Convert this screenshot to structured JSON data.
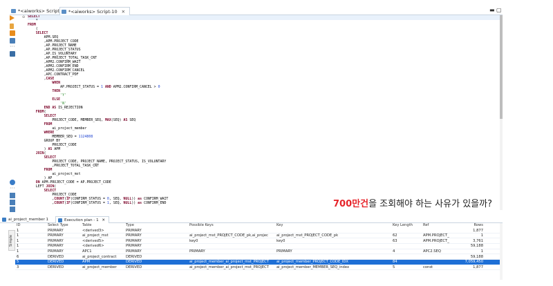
{
  "editor_tabs": [
    {
      "label": "*<aiworks> Script-9",
      "active": false
    },
    {
      "label": "*<aiworks> Script-10",
      "active": true,
      "close": "✕"
    }
  ],
  "window_controls": {
    "minimize": "▬",
    "maximize": "▢"
  },
  "code_lines": [
    "SELECT",
    "    *",
    "FROM",
    "    (",
    "    SELECT",
    "        APM.SEQ",
    "        ,APM.PROJECT_CODE",
    "        ,AP.PROJECT_NAME",
    "        ,AP.PROJECT_STATUS",
    "        ,AP.IS_VOLUNTARY",
    "        ,AP.PROJECT_TOTAL_TASK_CNT",
    "        ,APM2.CONFIRM_WAIT",
    "        ,APM2.CONFIRM_END",
    "        ,APM2.CONFIRM_CANCEL",
    "        ,APC.CONTRACT_PDF",
    "        ,CASE",
    "            WHEN",
    "                AP.PROJECT_STATUS = 1 AND APM2.CONFIRM_CANCEL > 0",
    "            THEN",
    "                'Y'",
    "            ELSE",
    "                'N'",
    "        END AS IS_REJECTION",
    "    FROM(",
    "        SELECT",
    "            PROJECT_CODE, MEMBER_SEQ, MAX(SEQ) AS SEQ",
    "        FROM",
    "            ai_project_member",
    "        WHERE",
    "            MEMBER_SEQ = 1124808",
    "        GROUP BY",
    "            PROJECT_CODE",
    "        ) AS APM",
    "    JOIN(",
    "        SELECT",
    "            PROJECT_CODE, PROJECT_NAME, PROJECT_STATUS, IS_VOLUNTARY",
    "            ,PROJECT_TOTAL_TASK_CNT",
    "        FROM",
    "            ai_project_mst",
    "        ) AP",
    "    ON APM.PROJECT_CODE = AP.PROJECT_CODE",
    "    LEFT JOIN(",
    "        SELECT",
    "            PROJECT_CODE",
    "            ,COUNT(IF(CONFIRM_STATUS = 0, SEQ, NULL)) as CONFIRM_WAIT",
    "            ,COUNT(IF(CONFIRM_STATUS = 1, SEQ, NULL)) as CONFIRM_END"
  ],
  "caption": {
    "highlight": "700만건",
    "rest": "을 조회해야 하는 사유가 있을까?"
  },
  "bottom_tabs": [
    {
      "label": "ai_project_member 1",
      "active": false
    },
    {
      "label": "Execution plan - 1",
      "active": true,
      "close": "✕"
    }
  ],
  "side_label": "Simple",
  "grid": {
    "headers": {
      "id": "ID",
      "select_type": "Select Type",
      "table": "Table",
      "type": "Type",
      "possible_keys": "Possible Keys",
      "key": "Key",
      "key_length": "Key Length",
      "ref": "Ref",
      "rows": "Rows"
    },
    "rows": [
      {
        "id": "1",
        "select_type": "PRIMARY",
        "table": "<derived3>",
        "type": "PRIMARY",
        "possible_keys": "",
        "key": "",
        "key_length": "",
        "ref": "",
        "rows": "1,877",
        "selected": false
      },
      {
        "id": "1",
        "select_type": "PRIMARY",
        "table": "ai_project_mst",
        "type": "PRIMARY",
        "possible_keys": "ai_project_mst_PROJECT_CODE_pk,ai_projec",
        "key": "ai_project_mst_PROJECT_CODE_pk",
        "key_length": "62",
        "ref": "APM.PROJECT_",
        "rows": "1",
        "selected": false
      },
      {
        "id": "1",
        "select_type": "PRIMARY",
        "table": "<derived5>",
        "type": "PRIMARY",
        "possible_keys": "key0",
        "key": "key0",
        "key_length": "63",
        "ref": "APM.PROJECT_",
        "rows": "3,761",
        "selected": false
      },
      {
        "id": "1",
        "select_type": "PRIMARY",
        "table": "<derived6>",
        "type": "PRIMARY",
        "possible_keys": "",
        "key": "",
        "key_length": "",
        "ref": "",
        "rows": "59,188",
        "selected": false
      },
      {
        "id": "1",
        "select_type": "PRIMARY",
        "table": "APC1",
        "type": "PRIMARY",
        "possible_keys": "PRIMARY",
        "key": "PRIMARY",
        "key_length": "4",
        "ref": "APC2.SEQ",
        "rows": "1",
        "selected": false
      },
      {
        "id": "6",
        "select_type": "DERIVED",
        "table": "ai_project_contract",
        "type": "DERIVED",
        "possible_keys": "",
        "key": "",
        "key_length": "",
        "ref": "",
        "rows": "59,188",
        "selected": false
      },
      {
        "id": "5",
        "select_type": "DERIVED",
        "table": "APM",
        "type": "DERIVED",
        "possible_keys": "ai_project_member_ai_project_mst_PROJECT",
        "key": "ai_project_member_PROJECT_CODE_IDX",
        "key_length": "84",
        "ref": "",
        "rows": "7,059,450",
        "selected": true
      },
      {
        "id": "3",
        "select_type": "DERIVED",
        "table": "ai_project_member",
        "type": "DERIVED",
        "possible_keys": "ai_project_member_ai_project_mst_PROJECT",
        "key": "ai_project_member_MEMBER_SEQ_index",
        "key_length": "5",
        "ref": "const",
        "rows": "1,877",
        "selected": false
      }
    ]
  },
  "colors": {
    "selection": "#1e6fd6",
    "keyword": "#7a0026",
    "number": "#1a3fd0",
    "string": "#2a8b2a",
    "caption_highlight": "#e6242a"
  },
  "icons": [
    "run-icon",
    "step-icon",
    "export-icon",
    "doc-icon",
    "more-icon",
    "window-icon",
    "settings-icon"
  ]
}
